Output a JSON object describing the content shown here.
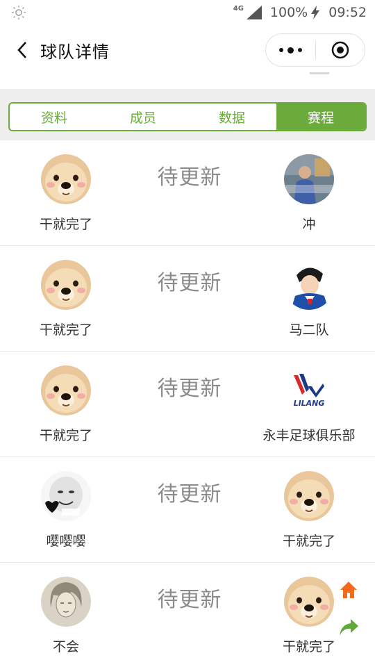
{
  "status_bar": {
    "network": "4G",
    "battery": "100%",
    "time": "09:52"
  },
  "header": {
    "title": "球队详情"
  },
  "tabs": [
    {
      "label": "资料",
      "active": false
    },
    {
      "label": "成员",
      "active": false
    },
    {
      "label": "数据",
      "active": false
    },
    {
      "label": "赛程",
      "active": true
    }
  ],
  "matches": [
    {
      "home": "干就完了",
      "status": "待更新",
      "away": "冲"
    },
    {
      "home": "干就完了",
      "status": "待更新",
      "away": "马二队"
    },
    {
      "home": "干就完了",
      "status": "待更新",
      "away": "永丰足球俱乐部"
    },
    {
      "home": "嘤嘤嘤",
      "status": "待更新",
      "away": "干就完了"
    },
    {
      "home": "不会",
      "status": "待更新",
      "away": "干就完了"
    }
  ],
  "logo_text": {
    "lilang": "LILANG"
  },
  "colors": {
    "accent": "#6bab3b",
    "home_button": "#f26a1b",
    "share_button": "#5fa93a"
  }
}
